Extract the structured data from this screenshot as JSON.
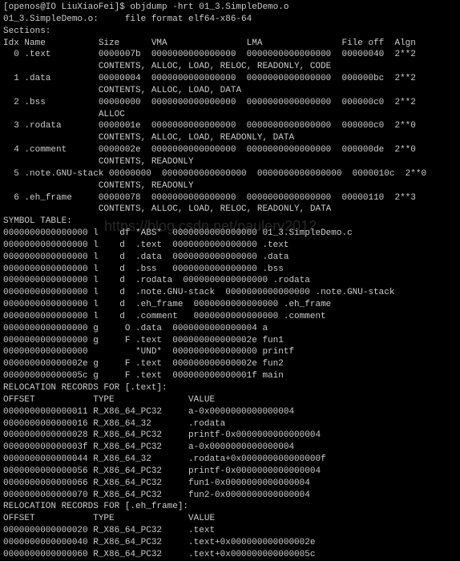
{
  "prompt_line": "[openos@IO LiuXiaoFei]$ objdump -hrt 01_3.SimpleDemo.o",
  "blank": "",
  "file_info": "01_3.SimpleDemo.o:     file format elf64-x86-64",
  "sections_header": "Sections:",
  "sections_cols": "Idx Name          Size      VMA               LMA               File off  Algn",
  "sections": [
    {
      "row": "  0 .text         0000007b  0000000000000000  0000000000000000  00000040  2**2",
      "attr": "                  CONTENTS, ALLOC, LOAD, RELOC, READONLY, CODE"
    },
    {
      "row": "  1 .data         00000004  0000000000000000  0000000000000000  000000bc  2**2",
      "attr": "                  CONTENTS, ALLOC, LOAD, DATA"
    },
    {
      "row": "  2 .bss          00000000  0000000000000000  0000000000000000  000000c0  2**2",
      "attr": "                  ALLOC"
    },
    {
      "row": "  3 .rodata       0000001e  0000000000000000  0000000000000000  000000c0  2**0",
      "attr": "                  CONTENTS, ALLOC, LOAD, READONLY, DATA"
    },
    {
      "row": "  4 .comment      0000002e  0000000000000000  0000000000000000  000000de  2**0",
      "attr": "                  CONTENTS, READONLY"
    },
    {
      "row": "  5 .note.GNU-stack 00000000  0000000000000000  0000000000000000  0000010c  2**0",
      "attr": "                  CONTENTS, READONLY"
    },
    {
      "row": "  6 .eh_frame     00000078  0000000000000000  0000000000000000  00000110  2**3",
      "attr": "                  CONTENTS, ALLOC, LOAD, RELOC, READONLY, DATA"
    }
  ],
  "symbol_header": "SYMBOL TABLE:",
  "symbols": [
    "0000000000000000 l    df *ABS*  0000000000000000 01_3.SimpleDemo.c",
    "0000000000000000 l    d  .text  0000000000000000 .text",
    "0000000000000000 l    d  .data  0000000000000000 .data",
    "0000000000000000 l    d  .bss   0000000000000000 .bss",
    "0000000000000000 l    d  .rodata  0000000000000000 .rodata",
    "0000000000000000 l    d  .note.GNU-stack  0000000000000000 .note.GNU-stack",
    "0000000000000000 l    d  .eh_frame  0000000000000000 .eh_frame",
    "0000000000000000 l    d  .comment   0000000000000000 .comment",
    "0000000000000000 g     O .data  0000000000000004 a",
    "0000000000000000 g     F .text  000000000000002e fun1",
    "0000000000000000         *UND*  0000000000000000 printf",
    "000000000000002e g     F .text  000000000000002e fun2",
    "000000000000005c g     F .text  000000000000001f main"
  ],
  "reloc_text_header": "RELOCATION RECORDS FOR [.text]:",
  "reloc_cols": "OFFSET           TYPE              VALUE",
  "reloc_text": [
    "0000000000000011 R_X86_64_PC32     a-0x0000000000000004",
    "0000000000000016 R_X86_64_32       .rodata",
    "0000000000000028 R_X86_64_PC32     printf-0x0000000000000004",
    "000000000000003f R_X86_64_PC32     a-0x0000000000000004",
    "0000000000000044 R_X86_64_32       .rodata+0x000000000000000f",
    "0000000000000056 R_X86_64_PC32     printf-0x0000000000000004",
    "0000000000000066 R_X86_64_PC32     fun1-0x0000000000000004",
    "0000000000000070 R_X86_64_PC32     fun2-0x0000000000000004"
  ],
  "reloc_eh_header": "RELOCATION RECORDS FOR [.eh_frame]:",
  "reloc_eh": [
    "0000000000000020 R_X86_64_PC32     .text",
    "0000000000000040 R_X86_64_PC32     .text+0x000000000000002e",
    "0000000000000060 R_X86_64_PC32     .text+0x000000000000005c"
  ],
  "watermark": "https://blog.csdn.net/paulery2012"
}
